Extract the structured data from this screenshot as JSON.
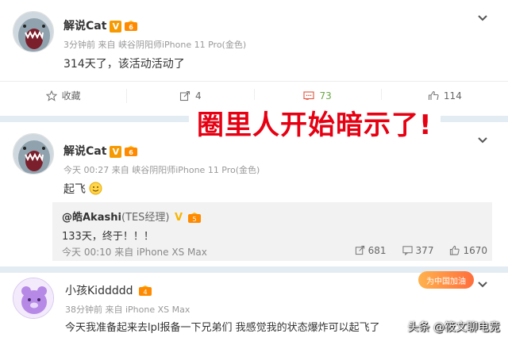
{
  "post1": {
    "username": "解说Cat",
    "v_badge": "V",
    "meta": "3分钟前 来自 峡谷阴阳师iPhone 11 Pro(金色)",
    "text": "314天了，该活动活动了",
    "actions": {
      "favorite": "收藏",
      "repost": "4",
      "comment": "73",
      "like": "114"
    }
  },
  "banner_text": "圈里人开始暗示了!",
  "post2": {
    "username": "解说Cat",
    "v_badge": "V",
    "meta": "今天 00:27 来自 峡谷阴阳师iPhone 11 Pro(金色)",
    "text": "起飞",
    "quote": {
      "author": "@皓Akashi",
      "author_suffix": "(TES经理)",
      "v_badge": "V",
      "text": "133天，终于！！！",
      "meta": "今天 00:10 来自 iPhone XS Max",
      "repost": "681",
      "comment": "377",
      "like": "1670"
    }
  },
  "post3": {
    "username": "小孩Kiddddd",
    "meta": "38分钟前 来自 iPhone XS Max",
    "text": "今天我准备起来去lpl报备一下兄弟们 我感觉我的状态爆炸可以起飞了",
    "event_badge": "为中国加油"
  },
  "watermark": "头条 @筱文聊电竞",
  "colors": {
    "comment_green": "#6aa843",
    "banner_red": "#e60012",
    "separator": "#e4ecf3",
    "v_orange": "#f79a00"
  }
}
